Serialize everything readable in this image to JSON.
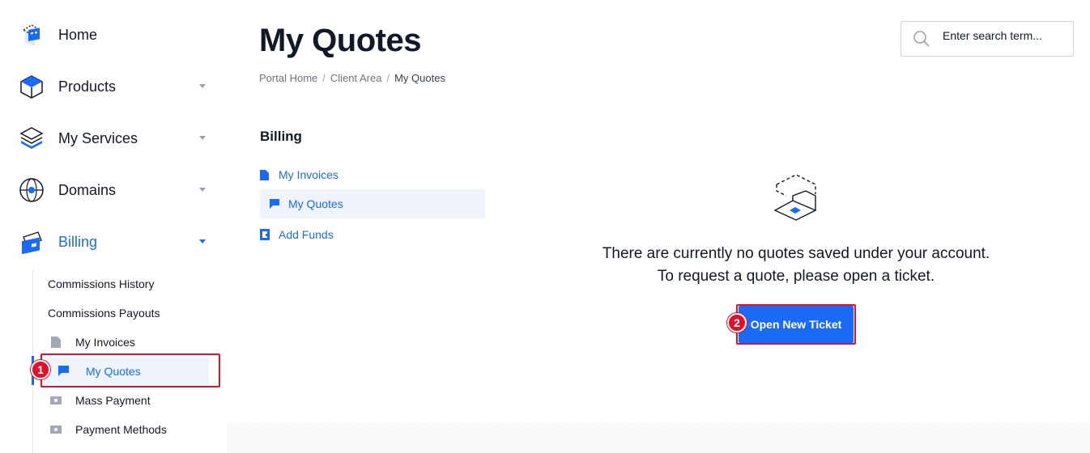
{
  "sidebar": {
    "items": [
      {
        "label": "Home",
        "icon": "home-icon"
      },
      {
        "label": "Products",
        "icon": "products-icon"
      },
      {
        "label": "My Services",
        "icon": "services-icon"
      },
      {
        "label": "Domains",
        "icon": "domains-icon"
      },
      {
        "label": "Billing",
        "icon": "billing-icon"
      }
    ],
    "billing_subitems": [
      {
        "label": "Commissions History"
      },
      {
        "label": "Commissions Payouts"
      },
      {
        "label": "My Invoices",
        "icon": "document-icon"
      },
      {
        "label": "My Quotes",
        "icon": "flag-icon"
      },
      {
        "label": "Mass Payment",
        "icon": "cash-icon"
      },
      {
        "label": "Payment Methods",
        "icon": "cash-icon"
      }
    ]
  },
  "header": {
    "title": "My Quotes",
    "breadcrumb": [
      "Portal Home",
      "Client Area",
      "My Quotes"
    ],
    "search_placeholder": "Enter search term..."
  },
  "billing_panel": {
    "title": "Billing",
    "items": [
      {
        "label": "My Invoices",
        "icon": "document-icon"
      },
      {
        "label": "My Quotes",
        "icon": "flag-icon"
      },
      {
        "label": "Add Funds",
        "icon": "wallet-icon"
      }
    ]
  },
  "empty_state": {
    "line1": "There are currently no quotes saved under your account.",
    "line2": "To request a quote, please open a ticket.",
    "button_label": "Open New Ticket"
  },
  "annotations": {
    "step1": "1",
    "step2": "2"
  },
  "colors": {
    "accent": "#1A6AF6",
    "highlight": "#E0102A",
    "active_bg": "#EEF3FC"
  }
}
